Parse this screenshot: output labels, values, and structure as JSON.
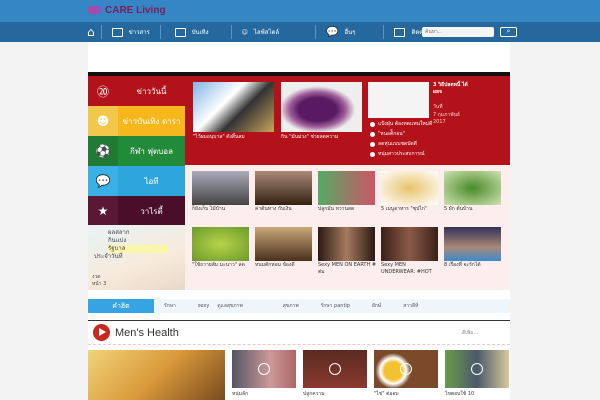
{
  "header": {
    "logo": "CARE Living",
    "nav": [
      {
        "label": "ข่าวสาร",
        "icon": "newspaper-icon"
      },
      {
        "label": "บันเทิง",
        "icon": "tv-icon"
      },
      {
        "label": "ไลฟ์สไตล์",
        "icon": "lifestyle-icon"
      },
      {
        "label": "อื่นๆ",
        "icon": "chat-icon"
      },
      {
        "label": "ติดต่อเรา",
        "icon": "contact-card-icon"
      }
    ],
    "search_placeholder": "ค้นหา..."
  },
  "sidebar": [
    {
      "label": "ข่าววันนี้",
      "icon": "24h-clock-icon",
      "color": "#b4121a"
    },
    {
      "label": "ข่าวบันเทิง ดารา",
      "icon": "masks-icon",
      "color": "#f5b71c"
    },
    {
      "label": "กีฬา ฟุตบอล",
      "icon": "soccer-ball-icon",
      "color": "#228b3a"
    },
    {
      "label": "ไอที",
      "icon": "chat-bubbles-icon",
      "color": "#2ea6dc"
    },
    {
      "label": "วาไรตี้",
      "icon": "stars-icon",
      "color": "#4a0d2a"
    }
  ],
  "ad": {
    "lines": [
      "ผลสลาก",
      "กินแบ่ง",
      "รัฐบาล",
      "ประจำวันที่",
      "งวด",
      "หน้า 3"
    ]
  },
  "featured": {
    "items": [
      {
        "caption": "\"ไว้ผมอนุบาล\" ดังสิ้นลม"
      },
      {
        "caption": "กิน \"มันม่วง\" ช่วยลดความ"
      }
    ],
    "side_title": "3 วิธีปลดหนี้ ได้ผลจ",
    "side_meta": [
      "วันที่",
      "7 กุมภาพันธ์ 2017"
    ],
    "list": [
      "แป้งฝุ่น ต้องทดแทนใหม่ดี",
      "\"หนอต้ีกอน\"",
      "ลดหุ่นแบบชดบัดดี",
      "หนุ่มสาวประสบการณ์"
    ]
  },
  "grid": [
    {
      "caption": "ก็ยังเก็บ ไม้บ้าน"
    },
    {
      "caption": "ค่าต้นทาง กับเงิน"
    },
    {
      "caption": "ปลูกมัน หวานสด"
    },
    {
      "caption": "5 เมนูอาหาร \"ซุปไก่\""
    },
    {
      "caption": "5 ผัก ต้นบ้าน"
    },
    {
      "caption": "\"ใช้ถวายส้ม มะนาว\" ลด"
    },
    {
      "caption": "หนมตักหอม ข้องดี"
    },
    {
      "caption": "Sexy MEN ON EARTH # ต่ม"
    },
    {
      "caption": "Sexy MEN UNDERWEAR: #HOT"
    },
    {
      "caption": "8 เรื่องที่ จะรักได้"
    }
  ],
  "tags": {
    "hot": "คำฮิต",
    "items": [
      "รักษา",
      "sexy",
      "ดูแลสุขภาพ",
      "สุขภาพ",
      "รักษา pantip",
      "ยักษ์",
      "สาวลีห์"
    ]
  },
  "mens_health": {
    "title": "Men's Health",
    "more": "ดีเพิ่ม...",
    "videos": [
      {
        "caption": "หนุ่มลัก"
      },
      {
        "caption": "ปลูกความ"
      },
      {
        "caption": "\"ไข่\" ต่ออบ"
      },
      {
        "caption": "ไขตอบใช้ 10"
      }
    ]
  }
}
